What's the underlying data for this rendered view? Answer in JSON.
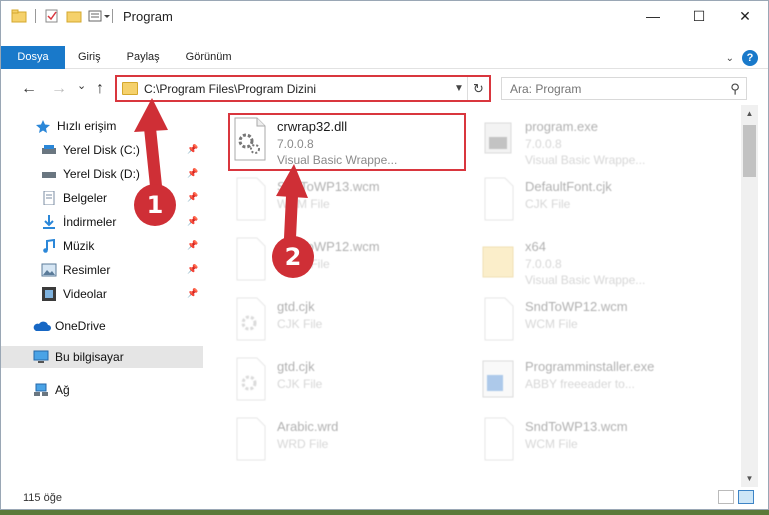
{
  "window": {
    "title": "Program",
    "controls": {
      "minimize": "—",
      "maximize": "☐",
      "close": "✕"
    }
  },
  "ribbon": {
    "tabs": [
      {
        "label": "Dosya",
        "active": true
      },
      {
        "label": "Giriş"
      },
      {
        "label": "Paylaş"
      },
      {
        "label": "Görünüm"
      }
    ],
    "help": "?"
  },
  "nav": {
    "back": "←",
    "forward": "→",
    "recent": "⌄",
    "up": "↑",
    "address": "C:\\Program Files\\Program Dizini",
    "search_placeholder": "Ara: Program"
  },
  "sidebar": {
    "items": [
      {
        "label": "Hızlı erişim",
        "icon": "star-icon"
      },
      {
        "label": "Yerel Disk (C:)",
        "icon": "drive-icon",
        "pinned": true
      },
      {
        "label": "Yerel Disk (D:)",
        "icon": "drive-icon",
        "pinned": true
      },
      {
        "label": "Belgeler",
        "icon": "documents-icon",
        "pinned": true
      },
      {
        "label": "İndirmeler",
        "icon": "downloads-icon",
        "pinned": true
      },
      {
        "label": "Müzik",
        "icon": "music-icon",
        "pinned": true
      },
      {
        "label": "Resimler",
        "icon": "pictures-icon",
        "pinned": true
      },
      {
        "label": "Videolar",
        "icon": "videos-icon",
        "pinned": true
      },
      {
        "label": "OneDrive",
        "icon": "onedrive-icon"
      },
      {
        "label": "Bu bilgisayar",
        "icon": "computer-icon",
        "selected": true
      },
      {
        "label": "Ağ",
        "icon": "network-icon"
      }
    ]
  },
  "files": [
    {
      "name": "crwrap32.dll",
      "line2": "7.0.0.8",
      "line3": "Visual Basic Wrappe...",
      "highlighted": true
    },
    {
      "name": "program.exe",
      "line2": "7.0.0.8",
      "line3": "Visual Basic Wrappe..."
    },
    {
      "name": "SndToWP13.wcm",
      "line2": "WCM File"
    },
    {
      "name": "DefaultFont.cjk",
      "line2": "CJK File"
    },
    {
      "name": "SndToWP12.wcm",
      "line2": "WCM File"
    },
    {
      "name": "x64",
      "line2": "7.0.0.8",
      "line3": "Visual Basic Wrappe..."
    },
    {
      "name": "gtd.cjk",
      "line2": "CJK File"
    },
    {
      "name": "SndToWP12.wcm",
      "line2": "WCM File"
    },
    {
      "name": "gtd.cjk",
      "line2": "CJK File"
    },
    {
      "name": "Programminstaller.exe",
      "line2": "ABBY freeeader to..."
    },
    {
      "name": "Arabic.wrd",
      "line2": "WRD File"
    },
    {
      "name": "SndToWP13.wcm",
      "line2": "WCM File"
    }
  ],
  "status": {
    "count": "115 öğe"
  },
  "annotations": {
    "step1": "1",
    "step2": "2",
    "color": "#cf2f36"
  }
}
